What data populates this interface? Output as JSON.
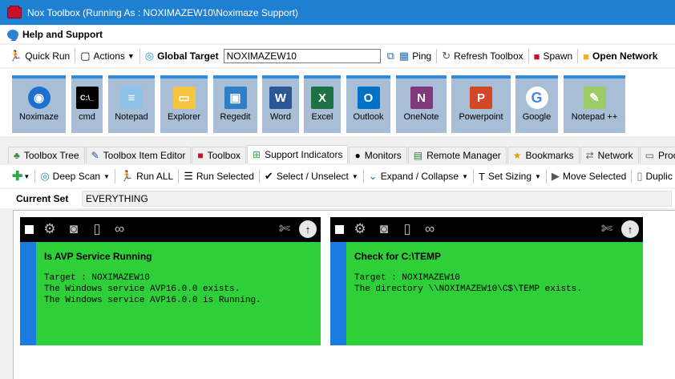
{
  "window": {
    "title": "Nox Toolbox (Running As : NOXIMAZEW10\\Noximaze Support)"
  },
  "menu": {
    "help": "Help and Support"
  },
  "toolbar": {
    "quick_run": "Quick Run",
    "actions": "Actions",
    "global_target_label": "Global Target",
    "global_target_value": "NOXIMAZEW10",
    "ping": "Ping",
    "refresh": "Refresh Toolbox",
    "spawn": "Spawn",
    "open_network": "Open Network"
  },
  "apps": [
    {
      "label": "Noximaze",
      "color": "#1d6fd0"
    },
    {
      "label": "cmd",
      "color": "#000000"
    },
    {
      "label": "Notepad",
      "color": "#8fc2e8"
    },
    {
      "label": "Explorer",
      "color": "#f5c542"
    },
    {
      "label": "Regedit",
      "color": "#2e7fc8"
    },
    {
      "label": "Word",
      "color": "#2b5797"
    },
    {
      "label": "Excel",
      "color": "#1e7145"
    },
    {
      "label": "Outlook",
      "color": "#0072c6"
    },
    {
      "label": "OneNote",
      "color": "#80397b"
    },
    {
      "label": "Powerpoint",
      "color": "#d24726"
    },
    {
      "label": "Google",
      "color": "#ffffff"
    },
    {
      "label": "Notepad ++",
      "color": "#9ccc65"
    }
  ],
  "tabs": [
    "Toolbox Tree",
    "Toolbox Item Editor",
    "Toolbox",
    "Support Indicators",
    "Monitors",
    "Remote Manager",
    "Bookmarks",
    "Network",
    "Process"
  ],
  "toolbar2": {
    "deep_scan": "Deep Scan",
    "run_all": "Run ALL",
    "run_selected": "Run Selected",
    "select_unselect": "Select / Unselect",
    "expand_collapse": "Expand / Collapse",
    "set_sizing": "Set Sizing",
    "move_selected": "Move Selected",
    "duplicate": "Duplic"
  },
  "current_set": {
    "label": "Current Set",
    "value": "EVERYTHING"
  },
  "cards": [
    {
      "title": "Is AVP Service Running",
      "lines": [
        "Target : NOXIMAZEW10",
        "The Windows service AVP16.0.0 exists.",
        "The Windows service AVP16.0.0 is Running."
      ]
    },
    {
      "title": "Check for C:\\TEMP",
      "lines": [
        "Target : NOXIMAZEW10",
        "The directory \\\\NOXIMAZEW10\\C$\\TEMP exists."
      ]
    }
  ],
  "colors": {
    "card_green": "#2fcf3a",
    "card_side_blue": "#1a7be0",
    "title_blue": "#1f7fd1",
    "app_tile": "#a8bed6"
  }
}
